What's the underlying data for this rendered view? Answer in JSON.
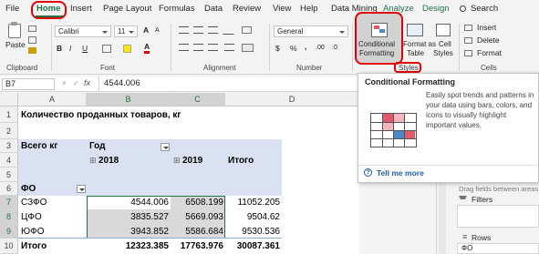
{
  "tabs": {
    "file": "File",
    "home": "Home",
    "insert": "Insert",
    "page_layout": "Page Layout",
    "formulas": "Formulas",
    "data": "Data",
    "review": "Review",
    "view": "View",
    "help": "Help",
    "data_mining": "Data Mining",
    "analyze": "Analyze",
    "design": "Design",
    "search": "Search"
  },
  "ribbon": {
    "paste": "Paste",
    "font_name": "Calibri",
    "font_size": "11",
    "number_format": "General",
    "conditional_formatting": [
      "Conditional",
      "Formatting"
    ],
    "format_as_table": [
      "Format as",
      "Table"
    ],
    "cell_styles": [
      "Cell",
      "Styles"
    ],
    "insert": "Insert",
    "delete": "Delete",
    "format": "Format",
    "groups": {
      "clipboard": "Clipboard",
      "font": "Font",
      "alignment": "Alignment",
      "number": "Number",
      "styles": "Styles",
      "cells": "Cells"
    },
    "glyphs": {
      "bold": "B",
      "italic": "I",
      "underline": "U",
      "grow": "A",
      "shrink": "A",
      "font_color": "A",
      "currency": "$",
      "percent": "%",
      "comma": ",",
      "inc_dec": ".00",
      "dec_dec": ".0"
    }
  },
  "formula_bar": {
    "cell_ref": "B7",
    "fx": "fx",
    "value": "4544.006"
  },
  "columns": [
    "A",
    "B",
    "C",
    "D"
  ],
  "rows": [
    "1",
    "2",
    "3",
    "4",
    "5",
    "6",
    "7",
    "8",
    "9",
    "10"
  ],
  "sheet": {
    "title": "Количество проданных товаров, кг",
    "row_field_header": "Всего кг",
    "col_field": "Год",
    "year1": "2018",
    "year2": "2019",
    "total_col": "Итого",
    "fo_label": "ФО",
    "rows": [
      {
        "name": "СЗФО",
        "v1": "4544.006",
        "v2": "6508.199",
        "total": "11052.205"
      },
      {
        "name": "ЦФО",
        "v1": "3835.527",
        "v2": "5669.093",
        "total": "9504.62"
      },
      {
        "name": "ЮФО",
        "v1": "3943.852",
        "v2": "5586.684",
        "total": "9530.536"
      }
    ],
    "grand": {
      "name": "Итого",
      "v1": "12323.385",
      "v2": "17763.976",
      "total": "30087.361"
    }
  },
  "tooltip": {
    "title": "Conditional Formatting",
    "body": "Easily spot trends and patterns in your data using bars, colors, and icons to visually highlight important values.",
    "link": "Tell me more"
  },
  "pivot_pane": {
    "hint": "Drag fields between areas be",
    "filters": "Filters",
    "rows": "Rows",
    "rows_item": "ФО"
  },
  "colors": {
    "accent": "#217346",
    "highlight": "#e00000",
    "pivot_header": "#d9e1f2"
  }
}
